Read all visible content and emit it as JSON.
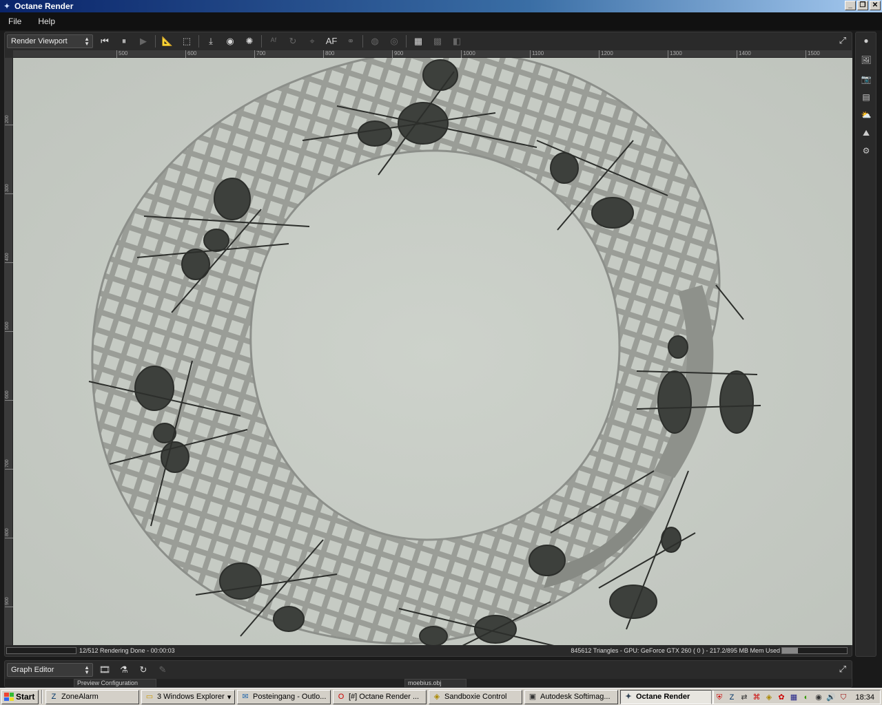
{
  "window": {
    "title": "Octane Render"
  },
  "menu": [
    "File",
    "Help"
  ],
  "render_panel": {
    "view_select": "Render Viewport",
    "ruler_h": [
      "500",
      "600",
      "700",
      "800",
      "900",
      "1000",
      "1100",
      "1200",
      "1300",
      "1400",
      "1500"
    ],
    "ruler_v": [
      "200",
      "300",
      "400",
      "500",
      "600",
      "700",
      "800",
      "900"
    ],
    "toolbar_af_label": "AF"
  },
  "status": {
    "progress_text": "12/512 Rendering Done - 00:00:03",
    "info_text": "845612 Triangles - GPU: GeForce GTX 260 ( 0 ) - 217.2/895 MB Mem Used",
    "mem_fraction": 0.24
  },
  "graph_panel": {
    "view_select": "Graph Editor",
    "node_labels": [
      "Preview Configuration",
      "moebius.obj"
    ]
  },
  "taskbar": {
    "start_label": "Start",
    "tasks": [
      {
        "label": "ZoneAlarm",
        "icon": "zonealarm-icon"
      },
      {
        "label": "3 Windows Explorer",
        "icon": "folder-icon"
      },
      {
        "label": "Posteingang - Outlo...",
        "icon": "outlook-icon"
      },
      {
        "label": "[#] Octane Render ...",
        "icon": "opera-icon"
      },
      {
        "label": "Sandboxie Control",
        "icon": "sandboxie-icon"
      },
      {
        "label": "Autodesk Softimag...",
        "icon": "softimage-icon"
      },
      {
        "label": "Octane Render",
        "icon": "octane-icon"
      }
    ],
    "clock": "18:34"
  }
}
